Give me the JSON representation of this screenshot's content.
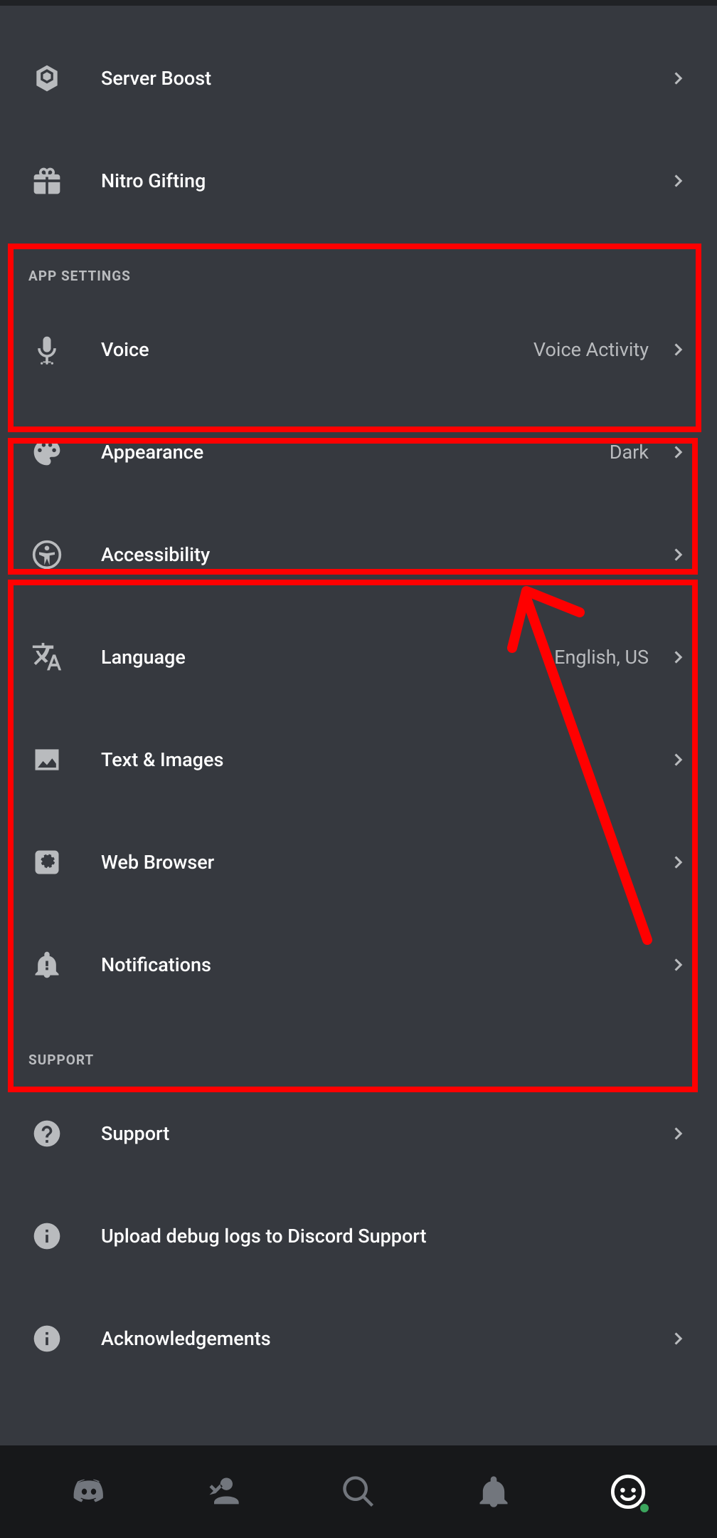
{
  "nitro": {
    "serverBoost": "Server Boost",
    "nitroGifting": "Nitro Gifting"
  },
  "sections": {
    "appSettings": "APP SETTINGS",
    "support": "SUPPORT"
  },
  "appSettings": {
    "voice": {
      "label": "Voice",
      "value": "Voice Activity"
    },
    "appearance": {
      "label": "Appearance",
      "value": "Dark"
    },
    "accessibility": {
      "label": "Accessibility",
      "value": ""
    },
    "language": {
      "label": "Language",
      "value": "English, US"
    },
    "textImages": {
      "label": "Text & Images",
      "value": ""
    },
    "webBrowser": {
      "label": "Web Browser",
      "value": ""
    },
    "notifications": {
      "label": "Notifications",
      "value": ""
    }
  },
  "support": {
    "support": "Support",
    "uploadDebug": "Upload debug logs to Discord Support",
    "acknowledgements": "Acknowledgements"
  },
  "annotation": {
    "highlight_color": "#ff0000",
    "arrow_color": "#ff0000"
  }
}
